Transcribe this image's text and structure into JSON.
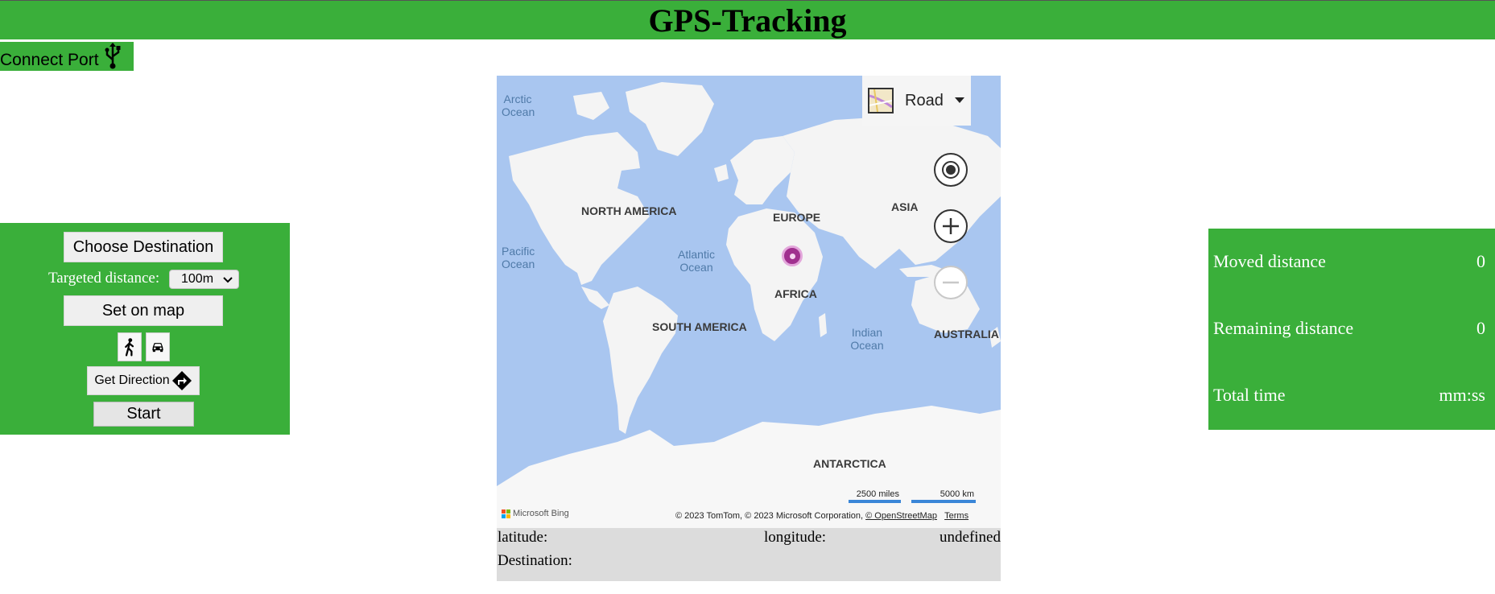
{
  "header": {
    "title": "GPS-Tracking"
  },
  "connect": {
    "label": "Connect Port",
    "icon": "usb-icon"
  },
  "controls": {
    "choose_destination": "Choose Destination",
    "targeted_distance_label": "Targeted distance:",
    "distance_selected": "100m",
    "set_on_map": "Set on map",
    "walk_icon": "walk-icon",
    "car_icon": "car-icon",
    "get_direction": "Get Direction",
    "start": "Start"
  },
  "map": {
    "style": "Road",
    "labels": {
      "arctic_ocean": "Arctic Ocean",
      "north_america": "NORTH AMERICA",
      "europe": "EUROPE",
      "asia": "ASIA",
      "pacific_ocean": "Pacific Ocean",
      "atlantic_ocean": "Atlantic Ocean",
      "africa": "AFRICA",
      "south_america": "SOUTH AMERICA",
      "indian_ocean": "Indian Ocean",
      "australia": "AUSTRALIA",
      "antarctica": "ANTARCTICA"
    },
    "scale_miles": "2500 miles",
    "scale_km": "5000 km",
    "provider": "Microsoft Bing",
    "copyright": "© 2023 TomTom, © 2023 Microsoft Corporation,",
    "osm": "© OpenStreetMap",
    "terms": "Terms"
  },
  "coords": {
    "latitude_label": "latitude:",
    "longitude_label": "longitude:",
    "value": "undefined",
    "destination_label": "Destination:"
  },
  "stats": {
    "moved_label": "Moved distance",
    "moved_value": "0",
    "remaining_label": "Remaining distance",
    "remaining_value": "0",
    "total_label": "Total time",
    "total_value": "mm:ss"
  },
  "colors": {
    "accent_green": "#3aaf3a",
    "ocean": "#a9c6f0",
    "land": "#f4f4f4",
    "pin": "#a0308f"
  }
}
